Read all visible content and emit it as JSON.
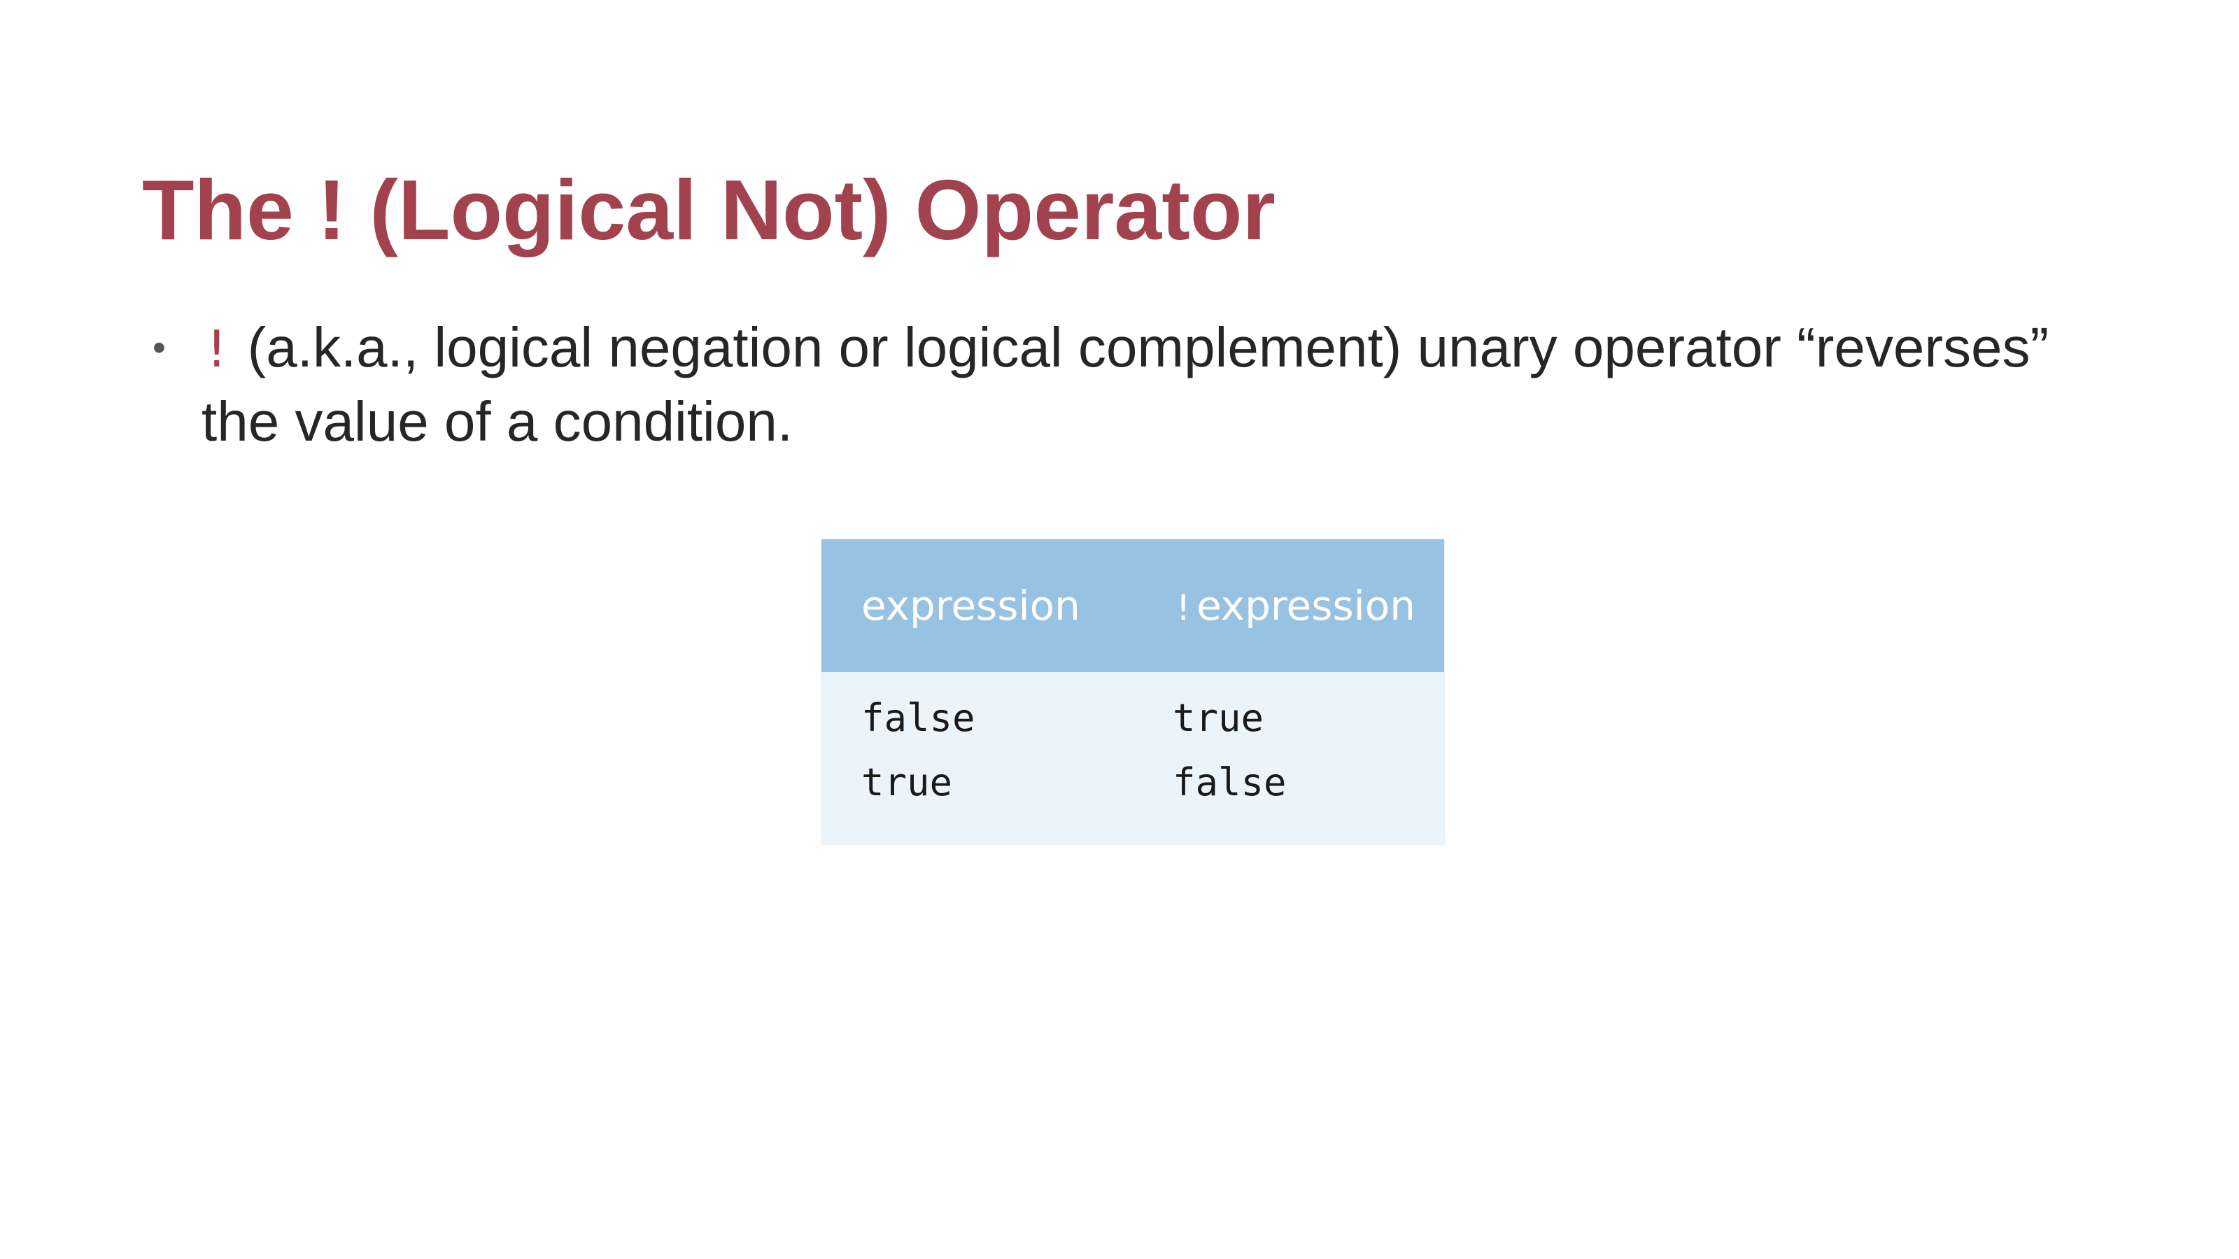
{
  "slide": {
    "title": "The ! (Logical Not) Operator",
    "bullets": [
      {
        "operator": "!",
        "text": " (a.k.a., logical negation or logical complement) unary operator “reverses” the value of a condition."
      }
    ]
  },
  "truth_table": {
    "headers": {
      "col1": "expression",
      "col2_prefix": "!",
      "col2": "expression"
    },
    "rows": [
      {
        "expression": "false",
        "not_expression": "true"
      },
      {
        "expression": "true",
        "not_expression": "false"
      }
    ]
  },
  "colors": {
    "title": "#a3424f",
    "operator": "#a3424f",
    "table_header_bg": "#97c2e2",
    "table_body_bg": "#ecf4fb"
  }
}
